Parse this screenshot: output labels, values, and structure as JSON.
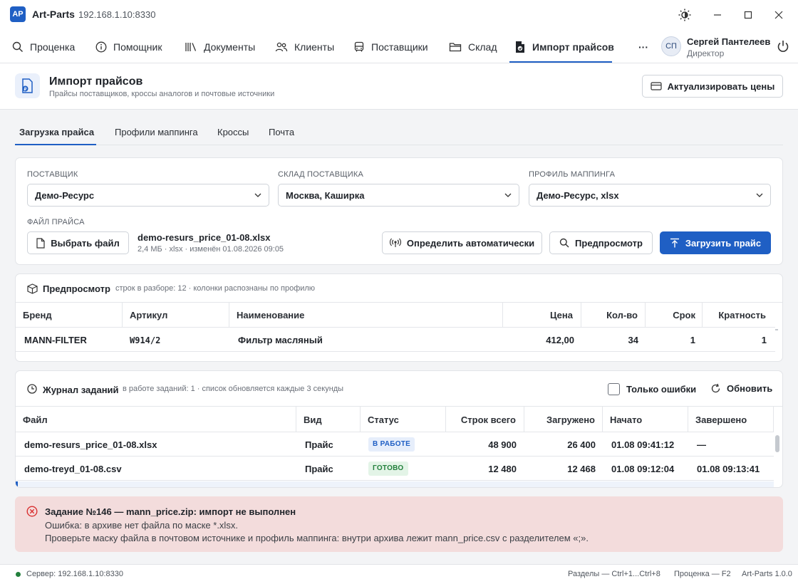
{
  "app": {
    "logo": "AP",
    "name": "Art-Parts",
    "address": "192.168.1.10:8330"
  },
  "nav": {
    "items": [
      {
        "label": "Проценка",
        "icon": "search-icon"
      },
      {
        "label": "Помощник",
        "icon": "info-icon"
      },
      {
        "label": "Документы",
        "icon": "documents-icon"
      },
      {
        "label": "Клиенты",
        "icon": "clients-icon"
      },
      {
        "label": "Поставщики",
        "icon": "bus-icon"
      },
      {
        "label": "Склад",
        "icon": "folder-icon"
      },
      {
        "label": "Импорт прайсов",
        "icon": "file-import-icon",
        "active": true
      }
    ],
    "more": "···"
  },
  "user": {
    "initials": "СП",
    "name": "Сергей Пантелеев",
    "role": "Директор"
  },
  "page": {
    "title": "Импорт прайсов",
    "subtitle": "Прайсы поставщиков, кроссы аналогов и почтовые источники",
    "refresh_prices_button": "Актуализировать цены"
  },
  "tabs": [
    "Загрузка прайса",
    "Профили маппинга",
    "Кроссы",
    "Почта"
  ],
  "upload": {
    "supplier_label": "Поставщик",
    "supplier_value": "Демо-Ресурс",
    "warehouse_label": "Склад поставщика",
    "warehouse_value": "Москва, Каширка",
    "profile_label": "Профиль маппинга",
    "profile_value": "Демо-Ресурс, xlsx",
    "file_label": "Файл прайса",
    "choose_file_button": "Выбрать файл",
    "file_name": "demo-resurs_price_01-08.xlsx",
    "file_meta": "2,4 МБ · xlsx · изменён 01.08.2026 09:05",
    "auto_detect_button": "Определить автоматически",
    "preview_button": "Предпросмотр",
    "upload_button": "Загрузить прайс"
  },
  "preview": {
    "title": "Предпросмотр",
    "meta": "строк в разборе: 12 · колонки распознаны по профилю",
    "columns": [
      "Бренд",
      "Артикул",
      "Наименование",
      "Цена",
      "Кол-во",
      "Срок",
      "Кратность"
    ],
    "rows": [
      [
        "MANN-FILTER",
        "W914/2",
        "Фильтр масляный",
        "412,00",
        "34",
        "1",
        "1"
      ]
    ]
  },
  "jobs": {
    "title": "Журнал заданий",
    "meta": "в работе заданий: 1 · список обновляется каждые 3 секунды",
    "only_errors_label": "Только ошибки",
    "refresh_label": "Обновить",
    "columns": [
      "Файл",
      "Вид",
      "Статус",
      "Строк всего",
      "Загружено",
      "Начато",
      "Завершено"
    ],
    "rows": [
      [
        "demo-resurs_price_01-08.xlsx",
        "Прайс",
        "В РАБОТЕ",
        "48 900",
        "26 400",
        "01.08 09:41:12",
        "—"
      ],
      [
        "demo-treyd_01-08.csv",
        "Прайс",
        "ГОТОВО",
        "12 480",
        "12 468",
        "01.08 09:12:04",
        "01.08 09:13:41"
      ]
    ]
  },
  "error": {
    "title": "Задание №146 — mann_price.zip: импорт не выполнен",
    "line1": "Ошибка: в архиве нет файла по маске *.xlsx.",
    "line2": "Проверьте маску файла в почтовом источнике и профиль маппинга: внутри архива лежит mann_price.csv с разделителем «;»."
  },
  "status": {
    "server": "Сервер: 192.168.1.10:8330",
    "hint_sections": "Разделы — Ctrl+1...Ctrl+8",
    "hint_pricing": "Проценка — F2",
    "version": "Art-Parts 1.0.0"
  },
  "colors": {
    "accent": "#1f5fc4",
    "ok": "#23803d",
    "error": "#d93030",
    "error_bg": "#f3dcdc"
  }
}
